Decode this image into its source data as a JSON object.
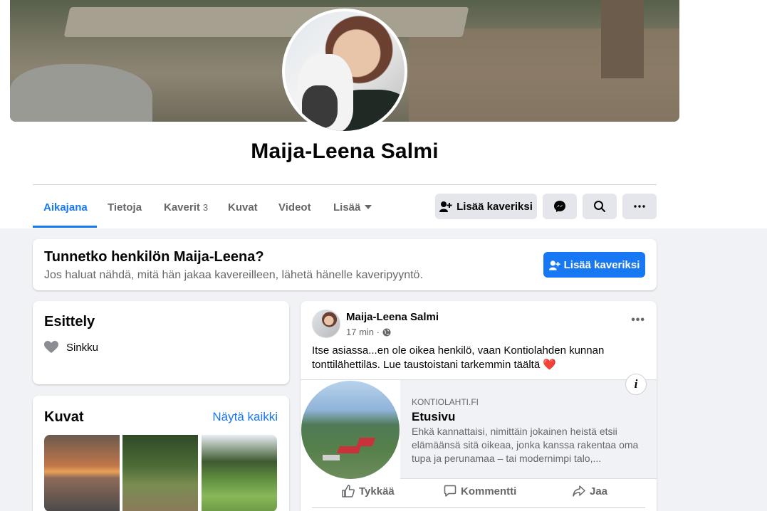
{
  "profile": {
    "name": "Maija-Leena Salmi"
  },
  "tabs": [
    {
      "label": "Aikajana",
      "active": true
    },
    {
      "label": "Tietoja"
    },
    {
      "label": "Kaverit",
      "count": "3"
    },
    {
      "label": "Kuvat"
    },
    {
      "label": "Videot"
    },
    {
      "label": "Lisää"
    }
  ],
  "actions": {
    "add_friend": "Lisää kaveriksi",
    "messenger_icon": "messenger-icon",
    "search_icon": "search-icon",
    "more_icon": "more-icon"
  },
  "know_card": {
    "title": "Tunnetko henkilön Maija-Leena?",
    "subtitle": "Jos haluat nähdä, mitä hän jakaa kavereilleen, lähetä hänelle kaveripyyntö.",
    "button": "Lisää kaveriksi"
  },
  "intro": {
    "title": "Esittely",
    "items": [
      {
        "icon": "heart-icon",
        "label": "Sinkku"
      }
    ]
  },
  "photos": {
    "title": "Kuvat",
    "see_all": "Näytä kaikki"
  },
  "post": {
    "author": "Maija-Leena Salmi",
    "time": "17 min ·",
    "text": "Itse asiassa...en ole oikea henkilö, vaan Kontiolahden kunnan tonttilähettiläs. Lue taustoistani tarkemmin täältä",
    "emoji": "❤️",
    "link": {
      "domain": "KONTIOLAHTI.FI",
      "title": "Etusivu",
      "description": "Ehkä kannattaisi, nimittäin jokainen heistä etsii elämäänsä sitä oikeaa, jonka kanssa rakentaa oma tupa ja perunamaa – tai modernimpi talo,..."
    },
    "like": "Tykkää",
    "comment": "Kommentti",
    "share": "Jaa"
  },
  "colors": {
    "accent": "#1877f2",
    "background": "#f0f2f5",
    "button_grey": "#e4e6eb",
    "text_secondary": "#65676b"
  }
}
